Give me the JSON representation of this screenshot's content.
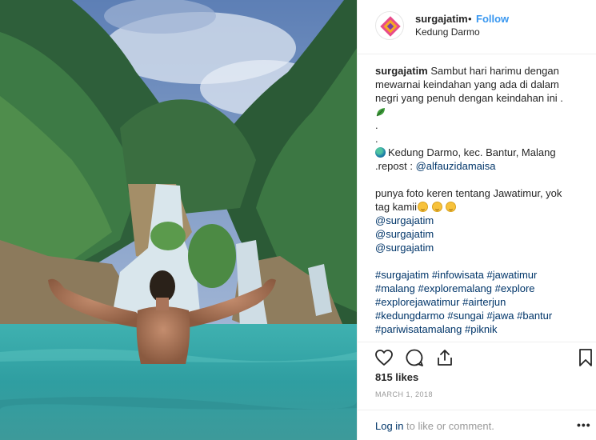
{
  "header": {
    "username": "surgajatim",
    "separator": "•",
    "follow_label": "Follow",
    "location": "Kedung Darmo"
  },
  "caption": {
    "username": "surgajatim",
    "text_line1": "Sambut hari harimu dengan",
    "text_line2": "mewarnai keindahan yang ada di dalam",
    "text_line3": "negri yang penuh dengan keindahan ini .",
    "dot1": ".",
    "dot2": ".",
    "location_line": "Kedung Darmo, kec. Bantur, Malang",
    "repost_prefix": ".repost : ",
    "repost_handle": "@alfauzidamaisa",
    "promo_line1": "punya foto keren tentang Jawatimur, yok",
    "promo_line2": "tag kamii",
    "mentions": [
      "@surgajatim",
      "@surgajatim",
      "@surgajatim"
    ],
    "hashtag_lines": [
      [
        "#surgajatim",
        "#infowisata",
        "#jawatimur"
      ],
      [
        "#malang",
        "#exploremalang",
        "#explore"
      ],
      [
        "#explorejawatimur",
        "#airterjun"
      ],
      [
        "#kedungdarmo",
        "#sungai",
        "#jawa",
        "#bantur"
      ],
      [
        "#pariwisatamalang",
        "#piknik"
      ]
    ]
  },
  "actions": {
    "like_icon": "heart-icon",
    "comment_icon": "comment-icon",
    "share_icon": "share-icon",
    "save_icon": "bookmark-icon"
  },
  "likes_text": "815 likes",
  "date_text": "MARCH 1, 2018",
  "login": {
    "link_label": "Log in",
    "suffix": " to like or comment.",
    "more_label": "•••"
  },
  "colors": {
    "link_blue": "#3897f0",
    "hashtag_blue": "#003569",
    "muted": "#999999",
    "text": "#262626"
  }
}
